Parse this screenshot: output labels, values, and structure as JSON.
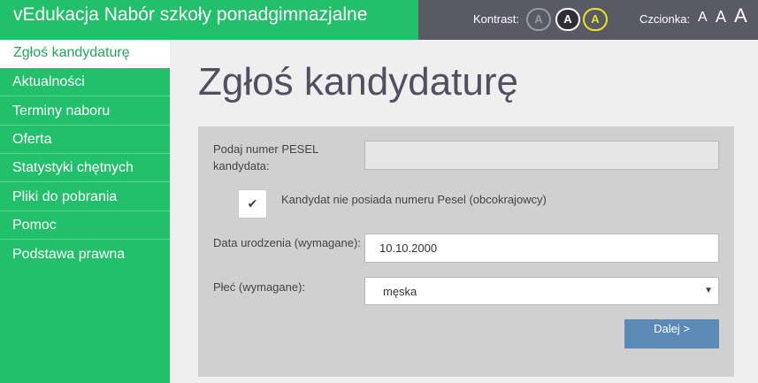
{
  "header": {
    "app_title": "vEdukacja Nabór szkoły ponadgimnazjalne",
    "kontrast_label": "Kontrast:",
    "kontrast_buttons": [
      "A",
      "A",
      "A"
    ],
    "czcionka_label": "Czcionka:",
    "font_buttons": [
      "A",
      "A",
      "A"
    ]
  },
  "sidebar": {
    "active_item": "Zgłoś kandydaturę",
    "items": [
      {
        "label": "Aktualności"
      },
      {
        "label": "Terminy naboru"
      },
      {
        "label": "Oferta"
      },
      {
        "label": "Statystyki chętnych"
      },
      {
        "label": "Pliki do pobrania"
      },
      {
        "label": "Pomoc"
      },
      {
        "label": "Podstawa prawna"
      }
    ]
  },
  "main": {
    "title": "Zgłoś kandydaturę",
    "form": {
      "pesel_label_line1": "Podaj numer PESEL",
      "pesel_label_line2": "kandydata:",
      "pesel_value": "",
      "no_pesel_checkbox_label": "Kandydat nie posiada numeru Pesel (obcokrajowcy)",
      "no_pesel_checked": true,
      "checkmark": "✔",
      "birthdate_label": "Data urodzenia (wymagane):",
      "birthdate_value": "10.10.2000",
      "gender_label": "Płeć (wymagane):",
      "gender_value": "męska",
      "select_caret": "▼",
      "next_button": "Dalej >"
    }
  },
  "colors": {
    "green": "#22c06b",
    "header_dark": "#5a5a66",
    "panel_gray": "#d0d0d0",
    "button_blue": "#5a8ab5",
    "yellow_contrast": "#e6e619"
  }
}
